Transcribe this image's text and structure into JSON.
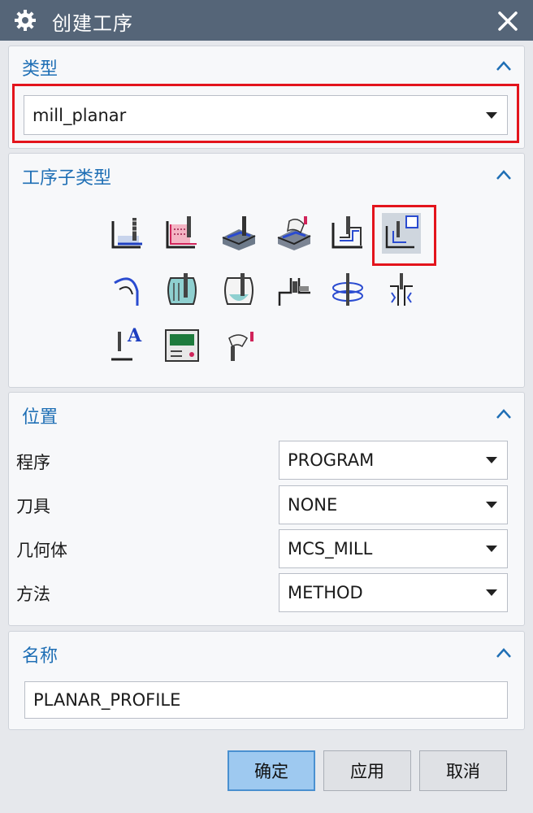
{
  "window": {
    "title": "创建工序",
    "icons": {
      "app": "gear-icon",
      "close": "close-icon"
    }
  },
  "type_section": {
    "title": "类型",
    "selected": "mill_planar"
  },
  "subtype_section": {
    "title": "工序子类型",
    "icons": [
      "floor-wall-icon",
      "floor-wall-ipw-icon",
      "face-milling-icon",
      "face-milling-manual-icon",
      "planar-mill-icon",
      "planar-profile-icon",
      "cleanup-corners-icon",
      "finish-walls-icon",
      "finish-floor-icon",
      "groove-milling-icon",
      "hole-milling-icon",
      "thread-milling-icon",
      "planar-text-icon",
      "mill-control-icon",
      "mill-user-icon"
    ],
    "selected_icon": "planar-profile-icon"
  },
  "location_section": {
    "title": "位置",
    "rows": [
      {
        "label": "程序",
        "value": "PROGRAM"
      },
      {
        "label": "刀具",
        "value": "NONE"
      },
      {
        "label": "几何体",
        "value": "MCS_MILL"
      },
      {
        "label": "方法",
        "value": "METHOD"
      }
    ]
  },
  "name_section": {
    "title": "名称",
    "value": "PLANAR_PROFILE"
  },
  "buttons": {
    "ok": "确定",
    "apply": "应用",
    "cancel": "取消"
  },
  "colors": {
    "titlebar": "#556578",
    "section_title": "#1f6fb5",
    "highlight": "#e3141c",
    "primary_button": "#9ec9f0"
  }
}
